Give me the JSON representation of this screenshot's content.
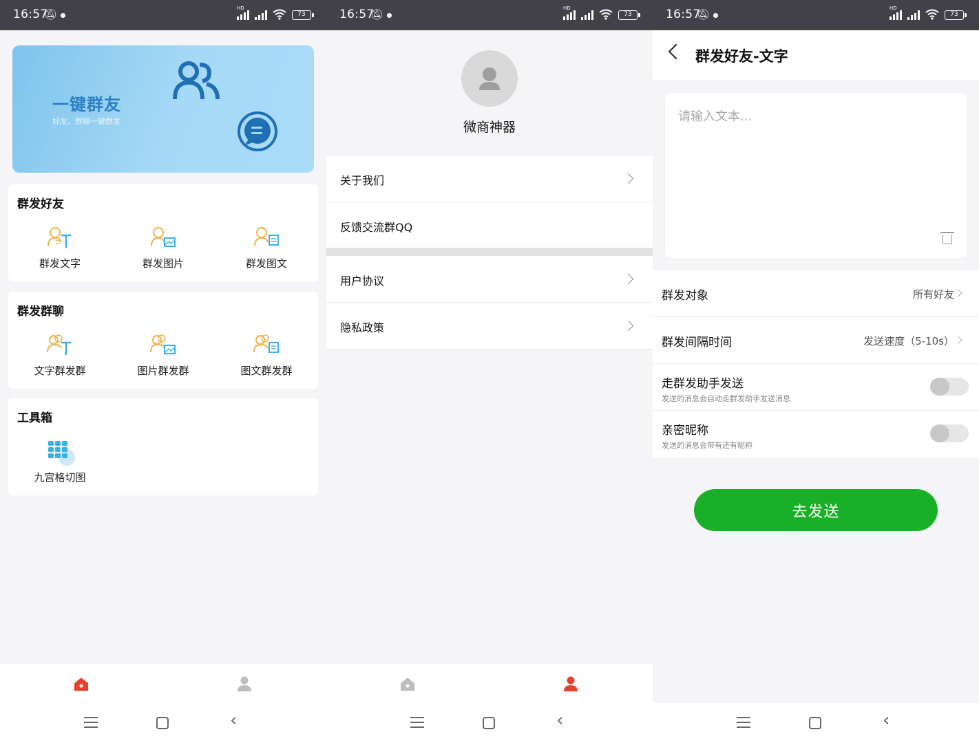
{
  "status": {
    "time": "16:57",
    "battery": "73",
    "hd": "HD"
  },
  "screen1": {
    "banner": {
      "title": "一键群友",
      "subtitle": "好友、群聊一键群发"
    },
    "sections": [
      {
        "title": "群发好友",
        "items": [
          "群发文字",
          "群发图片",
          "群发图文"
        ]
      },
      {
        "title": "群发群聊",
        "items": [
          "文字群发群",
          "图片群发群",
          "图文群发群"
        ]
      },
      {
        "title": "工具箱",
        "items": [
          "九宫格切图"
        ]
      }
    ]
  },
  "screen2": {
    "profile_name": "微商神器",
    "menu_group1": [
      "关于我们",
      "反馈交流群QQ"
    ],
    "menu_group2": [
      "用户协议",
      "隐私政策"
    ]
  },
  "screen3": {
    "title": "群发好友-文字",
    "text_placeholder": "请输入文本...",
    "rows": [
      {
        "label": "群发对象",
        "value": "所有好友"
      },
      {
        "label": "群发间隔时间",
        "value": "发送速度（5-10s）"
      }
    ],
    "toggles": [
      {
        "label": "走群发助手发送",
        "desc": "发送的消息会自动走群发助手发送消息",
        "on": false
      },
      {
        "label": "亲密昵称",
        "desc": "发送的消息会带有还有昵称",
        "on": false
      }
    ],
    "send_button": "去发送"
  },
  "colors": {
    "accent_green": "#1aaf28",
    "tab_active_red": "#e8412c",
    "icon_orange": "#f0b24a",
    "icon_blue": "#3cb0e6"
  }
}
